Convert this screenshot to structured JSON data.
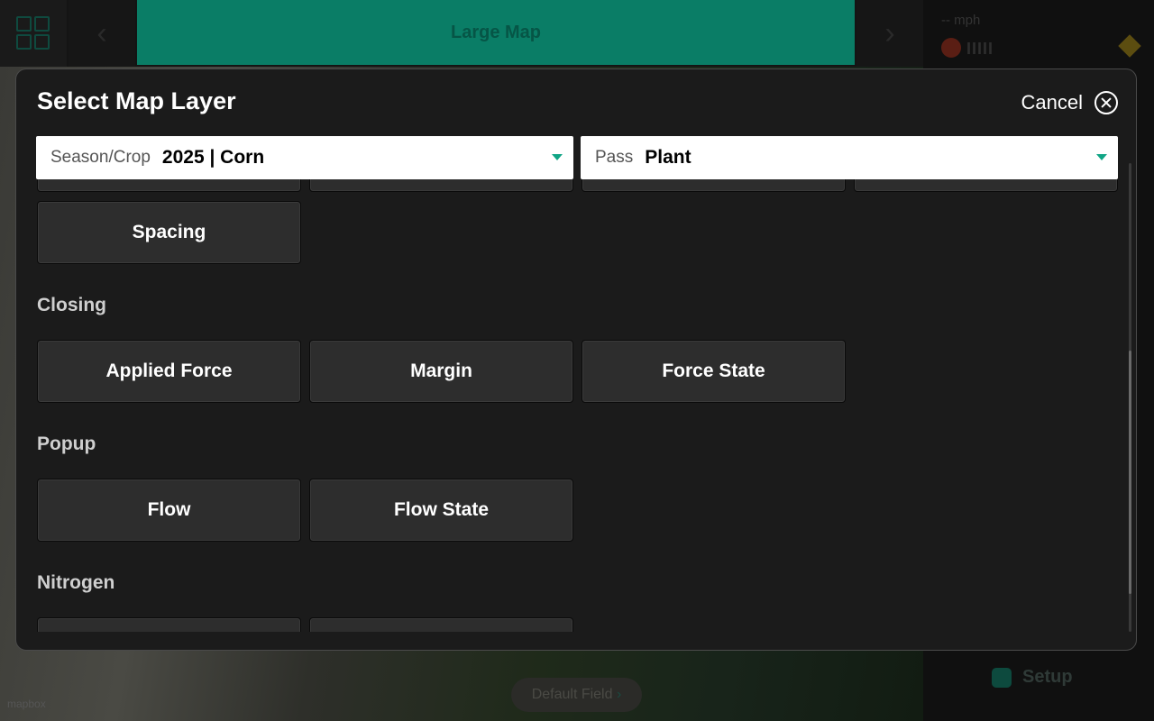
{
  "background": {
    "top_tab_label": "Large Map",
    "speed_text": "-- mph",
    "rate_bars": "IIIII",
    "setup_label": "Setup",
    "field_label": "Default Field",
    "map_attribution": "mapbox"
  },
  "modal": {
    "title": "Select Map Layer",
    "cancel_label": "Cancel",
    "season_select": {
      "label": "Season/Crop",
      "value": "2025 | Corn"
    },
    "pass_select": {
      "label": "Pass",
      "value": "Plant"
    },
    "sections": {
      "spacing": {
        "buttons": [
          "Spacing"
        ]
      },
      "closing": {
        "heading": "Closing",
        "buttons": [
          "Applied Force",
          "Margin",
          "Force State"
        ]
      },
      "popup": {
        "heading": "Popup",
        "buttons": [
          "Flow",
          "Flow State"
        ]
      },
      "nitrogen": {
        "heading": "Nitrogen"
      }
    }
  },
  "colors": {
    "accent": "#10a585",
    "modal_bg": "#1b1b1b",
    "button_bg": "#2d2d2d"
  }
}
